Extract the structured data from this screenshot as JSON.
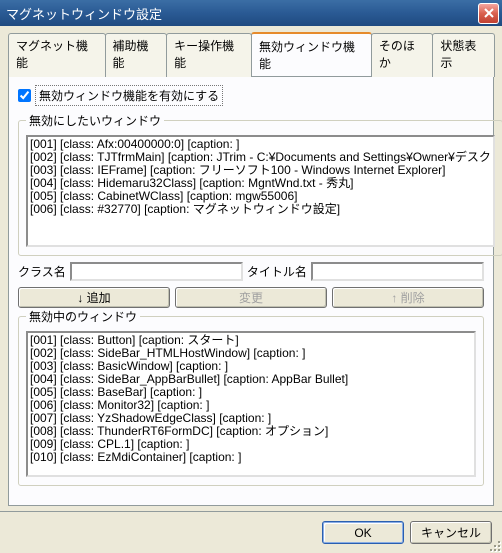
{
  "window": {
    "title": "マグネットウィンドウ設定"
  },
  "tabs": {
    "t0": "マグネット機能",
    "t1": "補助機能",
    "t2": "キー操作機能",
    "t3": "無効ウィンドウ機能",
    "t4": "そのほか",
    "t5": "状態表示"
  },
  "enable_checkbox": {
    "label": "無効ウィンドウ機能を有効にする",
    "checked": true
  },
  "group1": {
    "legend": "無効にしたいウィンドウ",
    "items": [
      "[001]  [class: Afx:00400000:0] [caption: ]",
      "[002]  [class: TJTfrmMain] [caption: JTrim - C:¥Documents and Settings¥Owner¥デスク",
      "[003]  [class: IEFrame] [caption: フリーソフト100 - Windows Internet Explorer]",
      "[004]  [class: Hidemaru32Class] [caption: MgntWnd.txt  - 秀丸]",
      "[005]  [class: CabinetWClass] [caption: mgw55006]",
      "[006]  [class: #32770] [caption: マグネットウィンドウ設定]"
    ]
  },
  "inputs": {
    "class_label": "クラス名",
    "class_value": "",
    "title_label": "タイトル名",
    "title_value": ""
  },
  "buttons": {
    "add": "↓ 追加",
    "change": "変更",
    "delete": "↑ 削除"
  },
  "group2": {
    "legend": "無効中のウィンドウ",
    "items": [
      "[001]  [class: Button] [caption: スタート]",
      "[002]  [class: SideBar_HTMLHostWindow] [caption: ]",
      "[003]  [class: BasicWindow] [caption: ]",
      "[004]  [class: SideBar_AppBarBullet] [caption: AppBar Bullet]",
      "[005]  [class: BaseBar] [caption: ]",
      "[006]  [class: Monitor32] [caption: ]",
      "[007]  [class: YzShadowEdgeClass] [caption: ]",
      "[008]  [class: ThunderRT6FormDC] [caption: オプション]",
      "[009]  [class: CPL.1] [caption: ]",
      "[010]  [class: EzMdiContainer] [caption: ]"
    ]
  },
  "bottom": {
    "ok": "OK",
    "cancel": "キャンセル"
  }
}
